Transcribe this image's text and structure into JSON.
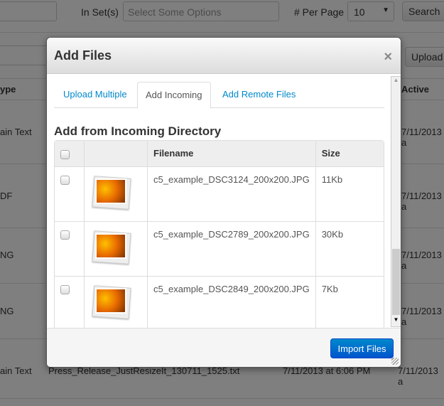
{
  "background": {
    "in_sets_label": "In Set(s)",
    "sets_placeholder": "Select Some Options",
    "per_page_label": "# Per Page",
    "per_page_value": "10",
    "search_label": "Search",
    "upload_label": "Upload",
    "col_type": "ype",
    "col_active": "Active",
    "rows": [
      {
        "type": "ain Text",
        "active": "7/11/2013 a"
      },
      {
        "type": "DF",
        "active": "7/11/2013 a"
      },
      {
        "type": "NG",
        "active": "7/11/2013 a"
      },
      {
        "type": "NG",
        "active": "7/11/2013 a"
      },
      {
        "type": "ain Text",
        "name": "Press_Release_JustResizeIt_130711_1525.txt",
        "added": "7/11/2013 at 6:06 PM",
        "active": "7/11/2013 a"
      }
    ]
  },
  "modal": {
    "title": "Add Files",
    "close": "×",
    "tabs": [
      {
        "label": "Upload Multiple"
      },
      {
        "label": "Add Incoming"
      },
      {
        "label": "Add Remote Files"
      }
    ],
    "heading": "Add from Incoming Directory",
    "columns": {
      "filename": "Filename",
      "size": "Size"
    },
    "files": [
      {
        "filename": "c5_example_DSC3124_200x200.JPG",
        "size": "11Kb"
      },
      {
        "filename": "c5_example_DSC2789_200x200.JPG",
        "size": "30Kb"
      },
      {
        "filename": "c5_example_DSC2849_200x200.JPG",
        "size": "7Kb"
      }
    ],
    "import_label": "Import Files"
  }
}
